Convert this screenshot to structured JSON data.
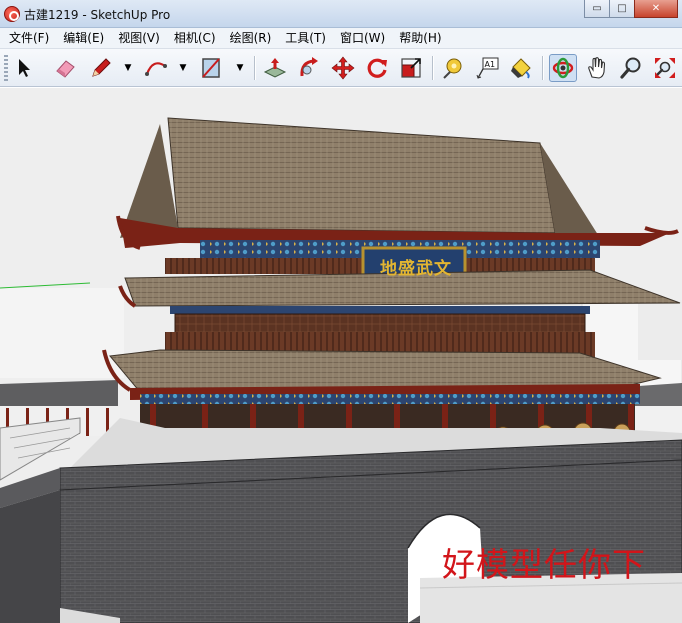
{
  "window": {
    "title": "古建1219 - SketchUp Pro",
    "controls": {
      "minimize": "▭",
      "maximize": "□",
      "close": "✕"
    }
  },
  "menu": [
    "文件(F)",
    "编辑(E)",
    "视图(V)",
    "相机(C)",
    "绘图(R)",
    "工具(T)",
    "窗口(W)",
    "帮助(H)"
  ],
  "toolbar": {
    "tools": [
      "select-tool",
      "eraser-tool",
      "pencil-line-tool",
      "arc-tool",
      "rectangle-tool",
      "push-pull-tool",
      "follow-me-tool",
      "move-tool",
      "rotate-tool",
      "scale-tool",
      "tape-measure-tool",
      "text-tool",
      "paint-bucket-tool",
      "orbit-tool",
      "pan-tool",
      "zoom-tool",
      "zoom-extents-tool"
    ],
    "active_tool": "orbit-tool",
    "text_tool_label": "A1"
  },
  "scene": {
    "plaque_text": "地盛武文",
    "watermark": "好模型任你下"
  },
  "colors": {
    "titlebar": "#c5d6ec",
    "roof": "#8f7f6a",
    "wall": "#4f4f52",
    "column": "#7a2216",
    "watermark": "#d2151a",
    "plaque_text": "#e2b532"
  }
}
